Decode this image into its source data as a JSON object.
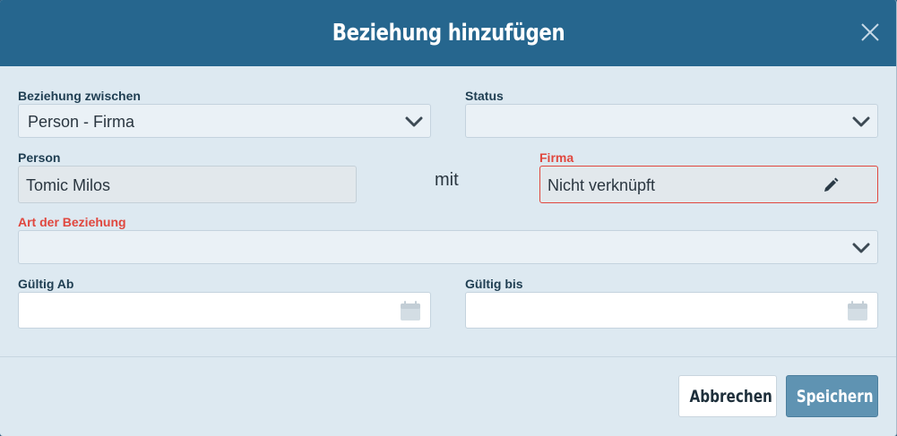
{
  "dialog": {
    "title": "Beziehung hinzufügen"
  },
  "form": {
    "relation_between": {
      "label": "Beziehung zwischen",
      "value": "Person - Firma"
    },
    "status": {
      "label": "Status",
      "value": ""
    },
    "person": {
      "label": "Person",
      "value": "Tomic Milos"
    },
    "connector": "mit",
    "firma": {
      "label": "Firma",
      "value": "Nicht verknüpft"
    },
    "relation_type": {
      "label": "Art der Beziehung",
      "value": ""
    },
    "valid_from": {
      "label": "Gültig Ab",
      "value": ""
    },
    "valid_until": {
      "label": "Gültig bis",
      "value": ""
    }
  },
  "footer": {
    "cancel_label": "Abbrechen",
    "save_label": "Speichern"
  },
  "colors": {
    "header": "#26668e",
    "body": "#dde9f1",
    "required": "#e0473e",
    "primary_button": "#5f93b2"
  },
  "icons": {
    "close": "close-icon",
    "dropdown": "chevron-down-icon",
    "calendar": "calendar-icon",
    "edit": "pencil-icon"
  }
}
